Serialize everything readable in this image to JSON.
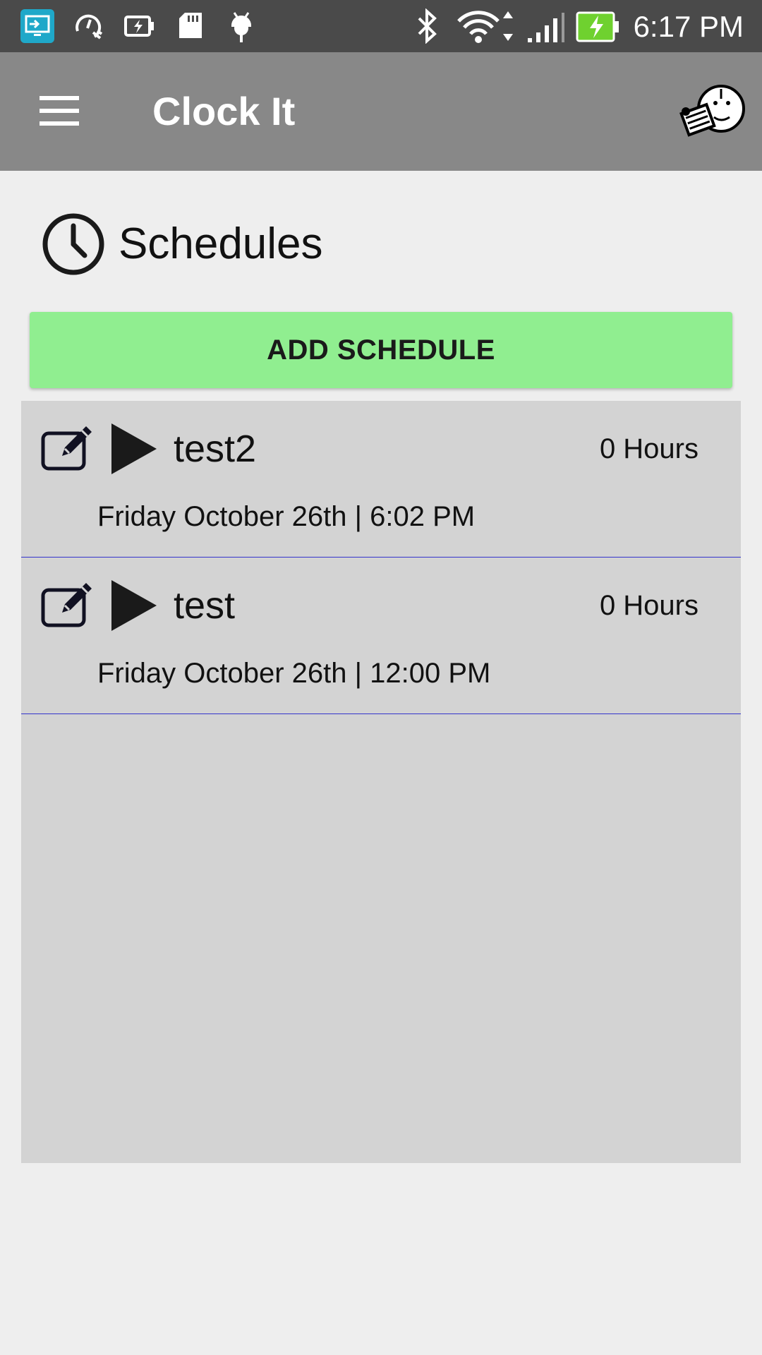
{
  "status_bar": {
    "time": "6:17 PM",
    "battery_color": "#6fd12f",
    "icons": [
      "screen-share-icon",
      "speedometer-icon",
      "battery-charging-icon",
      "sd-card-icon",
      "android-debug-icon",
      "bluetooth-icon",
      "wifi-icon",
      "signal-icon",
      "battery-icon"
    ]
  },
  "app_bar": {
    "title": "Clock It",
    "background": "#888888"
  },
  "section": {
    "title": "Schedules"
  },
  "add_button": {
    "label": "ADD SCHEDULE",
    "color": "#90ee90"
  },
  "schedules": [
    {
      "name": "test2",
      "hours": "0 Hours",
      "datetime": "Friday October 26th | 6:02 PM"
    },
    {
      "name": "test",
      "hours": "0 Hours",
      "datetime": "Friday October 26th | 12:00 PM"
    }
  ]
}
